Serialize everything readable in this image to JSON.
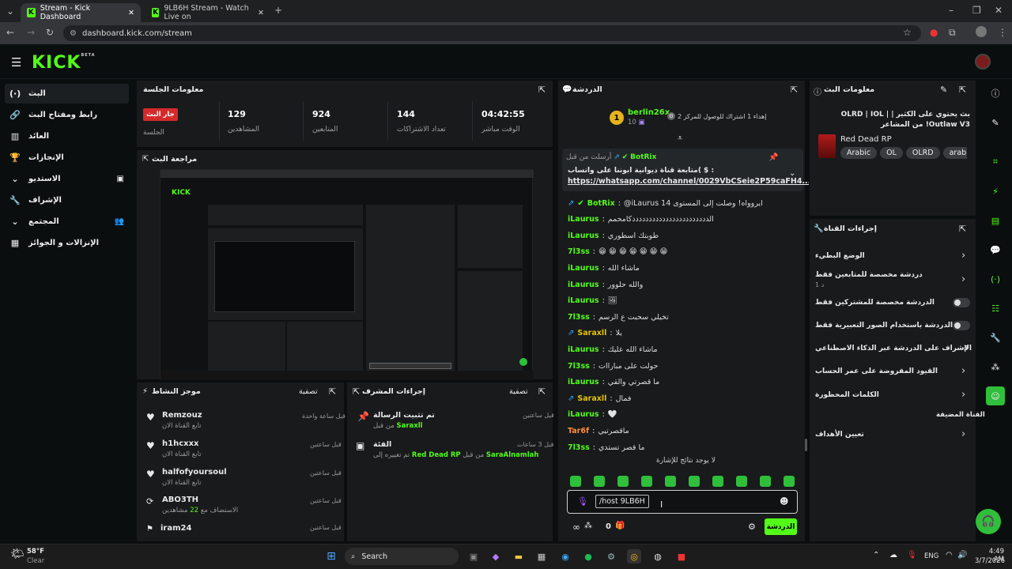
{
  "browser": {
    "tabs": [
      {
        "title": "Stream - Kick Dashboard"
      },
      {
        "title": "9LB6H Stream - Watch Live on"
      }
    ],
    "url": "dashboard.kick.com/stream"
  },
  "app": {
    "logo": "KICK",
    "logo_badge": "BETA"
  },
  "sidebar": {
    "items": [
      {
        "label": "البث",
        "icon": "live-icon"
      },
      {
        "label": "رابط ومفتاح البث",
        "icon": "link-icon"
      },
      {
        "label": "العائد",
        "icon": "bank-icon"
      },
      {
        "label": "الإنجازات",
        "icon": "trophy-icon"
      },
      {
        "label": "الاستديو",
        "icon": "studio-icon"
      },
      {
        "label": "الإشراف",
        "icon": "wrench-icon"
      },
      {
        "label": "المجتمع",
        "icon": "community-icon"
      },
      {
        "label": "الإنزالات و الجوائز",
        "icon": "rewards-icon"
      }
    ]
  },
  "session": {
    "title": "معلومات الجلسة",
    "live_badge": "جار البث",
    "session_label": "الجلسة",
    "stats": [
      {
        "value": "129",
        "label": "المشاهدين"
      },
      {
        "value": "924",
        "label": "المتابعين"
      },
      {
        "value": "144",
        "label": "تعداد الاشتراكات"
      },
      {
        "value": "04:42:55",
        "label": "الوقت مباشر"
      }
    ]
  },
  "preview": {
    "title": "مراجعة البث"
  },
  "activity": {
    "title": "موجز النشاط",
    "filter": "تصفية",
    "items": [
      {
        "name": "Remzouz",
        "sub": "تابع القناة الان",
        "time": "قبل ساعة واحدة",
        "icon": "heart-icon"
      },
      {
        "name": "h1hcxxx",
        "sub": "تابع القناة الان",
        "time": "قبل ساعتين",
        "icon": "heart-icon"
      },
      {
        "name": "halfofyoursoul",
        "sub": "تابع القناة الان",
        "time": "قبل ساعتين",
        "icon": "heart-icon"
      },
      {
        "name": "ABO3TH",
        "sub": "الاستضاف مع",
        "sub_count": "22",
        "sub_tail": "مشاهدين",
        "time": "قبل ساعتين",
        "icon": "host-icon"
      },
      {
        "name": "iram24",
        "sub": "",
        "time": "قبل ساعتين",
        "icon": "raid-icon"
      }
    ]
  },
  "modactions": {
    "title": "إجراءات المشرف",
    "filter": "تصفية",
    "items": [
      {
        "title": "تم تثبيت الرسالة",
        "by_prefix": "من قبل",
        "by": "Saraxll",
        "time": "قبل ساعتين",
        "icon": "pin-icon"
      },
      {
        "title": "الفئة",
        "by_prefix": "تم تغييره إلى",
        "target": "Red Dead RP",
        "by_mid": "من قبل",
        "by": "SaraAlnamlah",
        "time": "قبل 3 ساعات",
        "icon": "category-icon"
      }
    ]
  },
  "chat": {
    "title": "الدردشة",
    "top_user": "berlin26x",
    "top_user_rank": "1",
    "top_user_count": "10",
    "top_gift_rank": "2",
    "top_gift_text": "إهداء 1 اشتراك للوصول للمركز",
    "pinned_by_prefix": "أرسلت من قبل",
    "pinned_by": "BotRix",
    "pinned_text": "متابعة قناة ديوانية ابوننا على واتساب( $ :",
    "pinned_link": "https://whatsapp.com/channel/0029VbCSeie2P59caFH4...",
    "messages": [
      {
        "user": "BotRix",
        "color": "#53fc18",
        "text": "@iLaurus 14 ايروواه! وصلت إلى المستوى",
        "badge": true
      },
      {
        "user": "iLaurus",
        "color": "#53fc18",
        "text": "الدددددددددددددددددددددددكامحمم"
      },
      {
        "user": "iLaurus",
        "color": "#53fc18",
        "text": "طوبتك اسطوري"
      },
      {
        "user": "7l3ss",
        "color": "#53fc18",
        "text": "😁 😁 😁 😁 😁 😁 😁"
      },
      {
        "user": "iLaurus",
        "color": "#53fc18",
        "text": "ماشاء الله"
      },
      {
        "user": "iLaurus",
        "color": "#53fc18",
        "text": "والله حلوور"
      },
      {
        "user": "iLaurus",
        "color": "#53fc18",
        "text": "🖼"
      },
      {
        "user": "7l3ss",
        "color": "#53fc18",
        "text": "تخيلي سحبت ع الرسم"
      },
      {
        "user": "Saraxll",
        "color": "#e6c200",
        "text": "يلا",
        "badge": true
      },
      {
        "user": "iLaurus",
        "color": "#53fc18",
        "text": "ماشاء الله عليك"
      },
      {
        "user": "7l3ss",
        "color": "#53fc18",
        "text": "حولت على مباراات"
      },
      {
        "user": "iLaurus",
        "color": "#53fc18",
        "text": "ما قصرتي والقي"
      },
      {
        "user": "Saraxll",
        "color": "#e6c200",
        "text": "فمال",
        "badge": true
      },
      {
        "user": "iLaurus",
        "color": "#53fc18",
        "text": "🤍"
      },
      {
        "user": "Tar6f",
        "color": "#ff8c3a",
        "text": "ماقصرتيي"
      },
      {
        "user": "7l3ss",
        "color": "#53fc18",
        "text": "ما قصر تستدي"
      }
    ],
    "no_results": "لا يوجد نتائج للإشارة",
    "input_value": "/host 9LB6H",
    "send_label": "الدردشة",
    "points": "0"
  },
  "streaminfo": {
    "title": "معلومات البث",
    "stream_title": "بث يحتوي على الكثير | OLRD | IOL | Outlaw V3! من المشاعر",
    "category": "Red Dead RP",
    "tags": [
      "Arabic",
      "OL",
      "OLRD",
      "arabic"
    ]
  },
  "channelactions": {
    "title": "إجراءات القناة",
    "items": [
      {
        "label": "الوضع البطيء",
        "sub": "",
        "control": "chevron"
      },
      {
        "label": "دردشة مخصصة للمتابعين فقط",
        "sub": "1 د",
        "control": "chevron"
      },
      {
        "label": "الدردشة مخصصة للمشتركين فقط",
        "sub": "",
        "control": "toggle"
      },
      {
        "label": "الدردشة باستخدام الصور التعبيرية فقط",
        "sub": "",
        "control": "toggle"
      },
      {
        "label": "الإشراف على الدردشة عبر الذكاء الاصطناعي",
        "sub": "",
        "control": "external"
      },
      {
        "label": "القيود المفروضة على عمر الحساب",
        "sub": "",
        "control": "chevron"
      },
      {
        "label": "الكلمات المحظورة",
        "sub": "",
        "control": "chevron"
      }
    ],
    "hosted_label": "القناة المضيفة",
    "goals_label": "تعيين الأهداف"
  },
  "taskbar": {
    "weather_temp": "58°F",
    "weather_desc": "Clear",
    "search_placeholder": "Search",
    "lang": "ENG",
    "time": "4:49 AM",
    "date": "3/7/2026"
  }
}
